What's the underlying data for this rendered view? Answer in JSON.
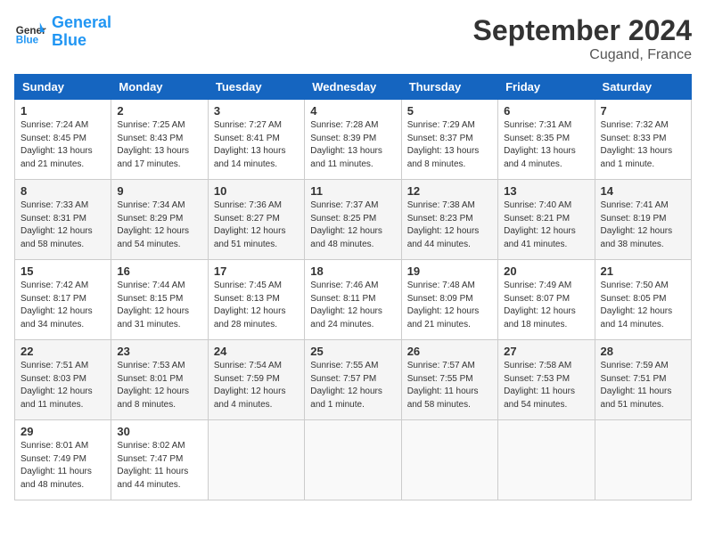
{
  "header": {
    "logo_general": "General",
    "logo_blue": "Blue",
    "month": "September 2024",
    "location": "Cugand, France"
  },
  "columns": [
    "Sunday",
    "Monday",
    "Tuesday",
    "Wednesday",
    "Thursday",
    "Friday",
    "Saturday"
  ],
  "weeks": [
    [
      {
        "day": "1",
        "info": "Sunrise: 7:24 AM\nSunset: 8:45 PM\nDaylight: 13 hours\nand 21 minutes."
      },
      {
        "day": "2",
        "info": "Sunrise: 7:25 AM\nSunset: 8:43 PM\nDaylight: 13 hours\nand 17 minutes."
      },
      {
        "day": "3",
        "info": "Sunrise: 7:27 AM\nSunset: 8:41 PM\nDaylight: 13 hours\nand 14 minutes."
      },
      {
        "day": "4",
        "info": "Sunrise: 7:28 AM\nSunset: 8:39 PM\nDaylight: 13 hours\nand 11 minutes."
      },
      {
        "day": "5",
        "info": "Sunrise: 7:29 AM\nSunset: 8:37 PM\nDaylight: 13 hours\nand 8 minutes."
      },
      {
        "day": "6",
        "info": "Sunrise: 7:31 AM\nSunset: 8:35 PM\nDaylight: 13 hours\nand 4 minutes."
      },
      {
        "day": "7",
        "info": "Sunrise: 7:32 AM\nSunset: 8:33 PM\nDaylight: 13 hours\nand 1 minute."
      }
    ],
    [
      {
        "day": "8",
        "info": "Sunrise: 7:33 AM\nSunset: 8:31 PM\nDaylight: 12 hours\nand 58 minutes."
      },
      {
        "day": "9",
        "info": "Sunrise: 7:34 AM\nSunset: 8:29 PM\nDaylight: 12 hours\nand 54 minutes."
      },
      {
        "day": "10",
        "info": "Sunrise: 7:36 AM\nSunset: 8:27 PM\nDaylight: 12 hours\nand 51 minutes."
      },
      {
        "day": "11",
        "info": "Sunrise: 7:37 AM\nSunset: 8:25 PM\nDaylight: 12 hours\nand 48 minutes."
      },
      {
        "day": "12",
        "info": "Sunrise: 7:38 AM\nSunset: 8:23 PM\nDaylight: 12 hours\nand 44 minutes."
      },
      {
        "day": "13",
        "info": "Sunrise: 7:40 AM\nSunset: 8:21 PM\nDaylight: 12 hours\nand 41 minutes."
      },
      {
        "day": "14",
        "info": "Sunrise: 7:41 AM\nSunset: 8:19 PM\nDaylight: 12 hours\nand 38 minutes."
      }
    ],
    [
      {
        "day": "15",
        "info": "Sunrise: 7:42 AM\nSunset: 8:17 PM\nDaylight: 12 hours\nand 34 minutes."
      },
      {
        "day": "16",
        "info": "Sunrise: 7:44 AM\nSunset: 8:15 PM\nDaylight: 12 hours\nand 31 minutes."
      },
      {
        "day": "17",
        "info": "Sunrise: 7:45 AM\nSunset: 8:13 PM\nDaylight: 12 hours\nand 28 minutes."
      },
      {
        "day": "18",
        "info": "Sunrise: 7:46 AM\nSunset: 8:11 PM\nDaylight: 12 hours\nand 24 minutes."
      },
      {
        "day": "19",
        "info": "Sunrise: 7:48 AM\nSunset: 8:09 PM\nDaylight: 12 hours\nand 21 minutes."
      },
      {
        "day": "20",
        "info": "Sunrise: 7:49 AM\nSunset: 8:07 PM\nDaylight: 12 hours\nand 18 minutes."
      },
      {
        "day": "21",
        "info": "Sunrise: 7:50 AM\nSunset: 8:05 PM\nDaylight: 12 hours\nand 14 minutes."
      }
    ],
    [
      {
        "day": "22",
        "info": "Sunrise: 7:51 AM\nSunset: 8:03 PM\nDaylight: 12 hours\nand 11 minutes."
      },
      {
        "day": "23",
        "info": "Sunrise: 7:53 AM\nSunset: 8:01 PM\nDaylight: 12 hours\nand 8 minutes."
      },
      {
        "day": "24",
        "info": "Sunrise: 7:54 AM\nSunset: 7:59 PM\nDaylight: 12 hours\nand 4 minutes."
      },
      {
        "day": "25",
        "info": "Sunrise: 7:55 AM\nSunset: 7:57 PM\nDaylight: 12 hours\nand 1 minute."
      },
      {
        "day": "26",
        "info": "Sunrise: 7:57 AM\nSunset: 7:55 PM\nDaylight: 11 hours\nand 58 minutes."
      },
      {
        "day": "27",
        "info": "Sunrise: 7:58 AM\nSunset: 7:53 PM\nDaylight: 11 hours\nand 54 minutes."
      },
      {
        "day": "28",
        "info": "Sunrise: 7:59 AM\nSunset: 7:51 PM\nDaylight: 11 hours\nand 51 minutes."
      }
    ],
    [
      {
        "day": "29",
        "info": "Sunrise: 8:01 AM\nSunset: 7:49 PM\nDaylight: 11 hours\nand 48 minutes."
      },
      {
        "day": "30",
        "info": "Sunrise: 8:02 AM\nSunset: 7:47 PM\nDaylight: 11 hours\nand 44 minutes."
      },
      {
        "day": "",
        "info": ""
      },
      {
        "day": "",
        "info": ""
      },
      {
        "day": "",
        "info": ""
      },
      {
        "day": "",
        "info": ""
      },
      {
        "day": "",
        "info": ""
      }
    ]
  ]
}
